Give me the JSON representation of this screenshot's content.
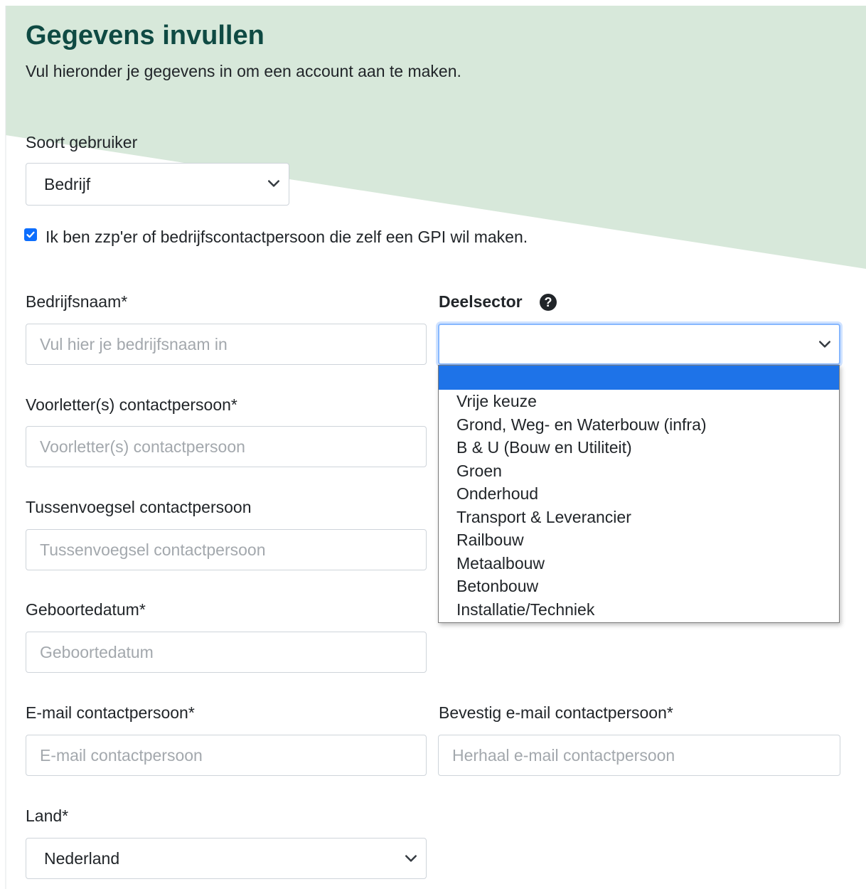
{
  "header": {
    "title": "Gegevens invullen",
    "subtitle": "Vul hieronder je gegevens in om een account aan te maken."
  },
  "user_type": {
    "label": "Soort gebruiker",
    "value": "Bedrijf"
  },
  "zzp_checkbox": {
    "checked": true,
    "label": "Ik ben zzp'er of bedrijfscontactpersoon die zelf een GPI wil maken."
  },
  "company_name": {
    "label": "Bedrijfsnaam*",
    "placeholder": "Vul hier je bedrijfsnaam in"
  },
  "sector": {
    "label": "Deelsector",
    "value": "",
    "help_icon": "question-circle-icon",
    "options": [
      "",
      "Vrije keuze",
      "Grond, Weg- en Waterbouw (infra)",
      "B & U (Bouw en Utiliteit)",
      "Groen",
      "Onderhoud",
      "Transport & Leverancier",
      "Railbouw",
      "Metaalbouw",
      "Betonbouw",
      "Installatie/Techniek"
    ]
  },
  "initials": {
    "label": "Voorletter(s) contactpersoon*",
    "placeholder": "Voorletter(s) contactpersoon"
  },
  "infix": {
    "label": "Tussenvoegsel contactpersoon",
    "placeholder": "Tussenvoegsel contactpersoon"
  },
  "birthdate": {
    "label": "Geboortedatum*",
    "placeholder": "Geboortedatum"
  },
  "email": {
    "label": "E-mail contactpersoon*",
    "placeholder": "E-mail contactpersoon"
  },
  "email_confirm": {
    "label": "Bevestig e-mail contactpersoon*",
    "placeholder": "Herhaal e-mail contactpersoon"
  },
  "country": {
    "label": "Land*",
    "value": "Nederland"
  },
  "colors": {
    "header_background": "#d7e8da",
    "title": "#0f4a43",
    "checkbox": "#0d6efd",
    "dropdown_highlight": "#1e73e8"
  }
}
